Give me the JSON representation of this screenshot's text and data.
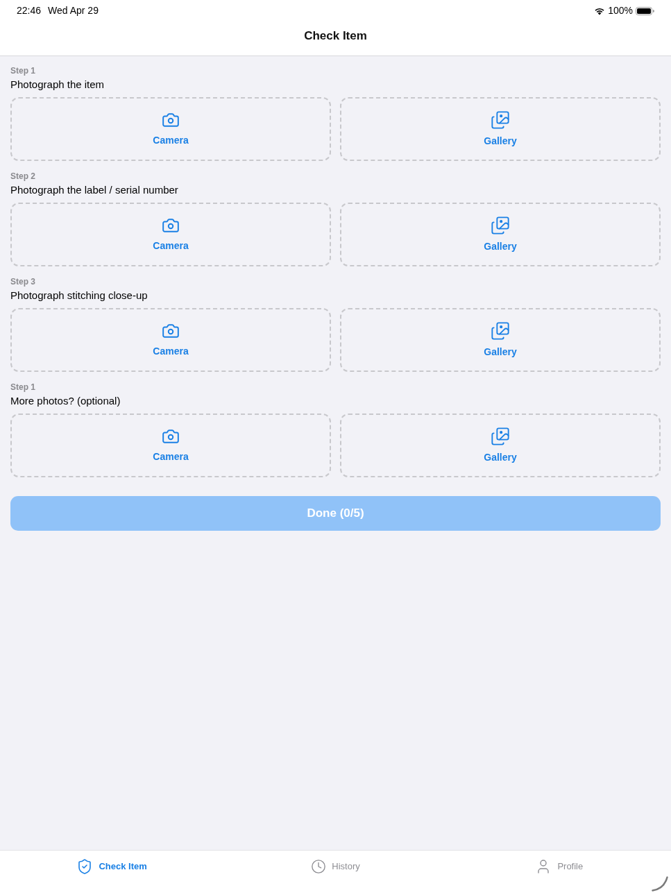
{
  "status_bar": {
    "time": "22:46",
    "date": "Wed Apr 29",
    "battery": "100%"
  },
  "nav": {
    "title": "Check Item"
  },
  "steps": [
    {
      "step": "Step 1",
      "title": "Photograph the item",
      "options": [
        {
          "kind": "camera",
          "label": "Camera"
        },
        {
          "kind": "gallery",
          "label": "Gallery"
        }
      ]
    },
    {
      "step": "Step 2",
      "title": "Photograph the label / serial number",
      "options": [
        {
          "kind": "camera",
          "label": "Camera"
        },
        {
          "kind": "gallery",
          "label": "Gallery"
        }
      ]
    },
    {
      "step": "Step 3",
      "title": "Photograph stitching close-up",
      "options": [
        {
          "kind": "camera",
          "label": "Camera"
        },
        {
          "kind": "gallery",
          "label": "Gallery"
        }
      ]
    },
    {
      "step": "Step 1",
      "title": "More photos? (optional)",
      "options": [
        {
          "kind": "camera",
          "label": "Camera"
        },
        {
          "kind": "gallery",
          "label": "Gallery"
        }
      ]
    }
  ],
  "done_button": {
    "label": "Done (0/5)",
    "disabled": true
  },
  "tab_bar": [
    {
      "kind": "shield",
      "label": "Check Item",
      "selected": true
    },
    {
      "kind": "clock",
      "label": "History",
      "selected": false
    },
    {
      "kind": "person",
      "label": "Profile",
      "selected": false
    }
  ]
}
